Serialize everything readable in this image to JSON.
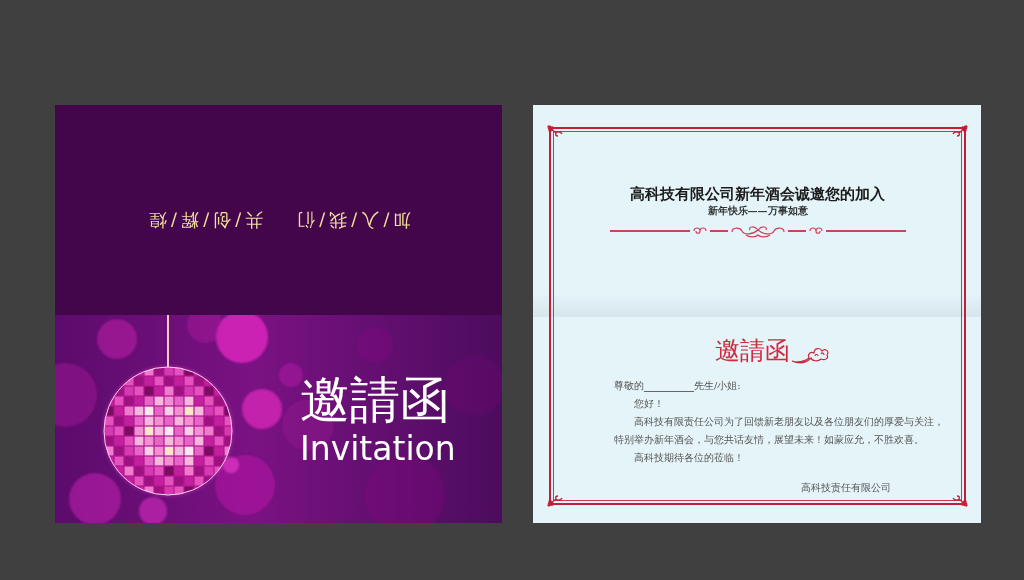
{
  "cover_card": {
    "tagline": [
      "加/入/我/们",
      "共/创/辉/煌"
    ],
    "title": "邀請函",
    "subtitle": "Invitation"
  },
  "letter_card": {
    "heading": "高科技有限公司新年酒会诚邀您的加入",
    "subheading": "新年快乐——万事如意",
    "title": "邀請函",
    "salutation": {
      "before_blank": "尊敬的",
      "after_blank": "先生/小姐:"
    },
    "greeting": "您好！",
    "paragraphs": [
      "高科技有限责任公司为了回馈新老朋友以及各位朋友们的厚爱与关注，特别举办新年酒会，与您共话友情，展望未来！如蒙应允，不胜欢喜。",
      "高科技期待各位的莅临！"
    ],
    "signature": "高科技责任有限公司"
  }
}
